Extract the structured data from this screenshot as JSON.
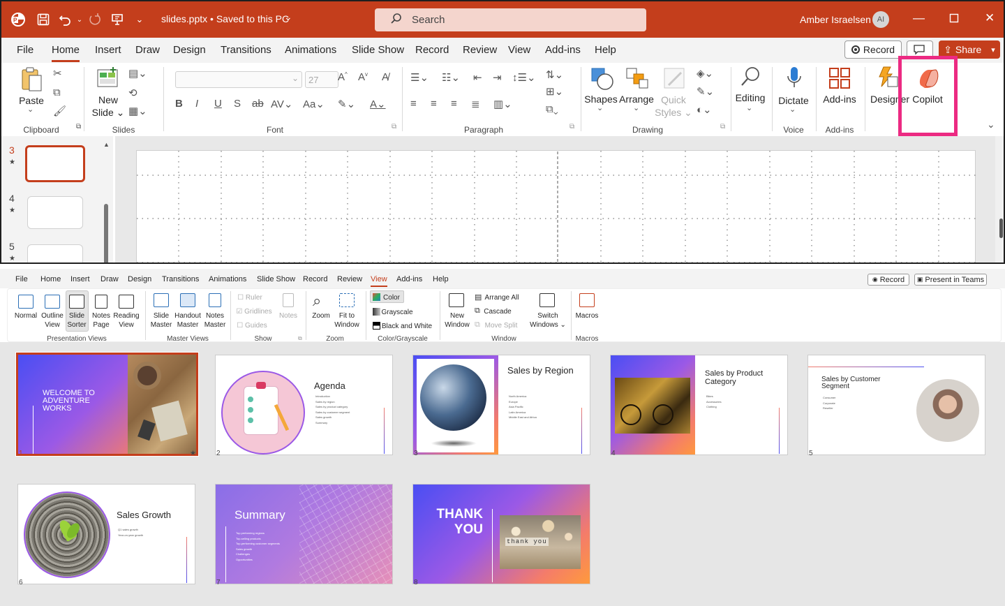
{
  "top": {
    "file_name": "slides.pptx  •  Saved to this PC",
    "search_placeholder": "Search",
    "user_name": "Amber Israelsen",
    "user_initials": "AI",
    "menu_tabs": [
      "File",
      "Home",
      "Insert",
      "Draw",
      "Design",
      "Transitions",
      "Animations",
      "Slide Show",
      "Record",
      "Review",
      "View",
      "Add-ins",
      "Help"
    ],
    "active_tab": "Home",
    "record_label": "Record",
    "share_label": "Share",
    "ribbon": {
      "paste": "Paste",
      "new_slide_1": "New",
      "new_slide_2": "Slide",
      "font_size": "27",
      "shapes": "Shapes",
      "arrange": "Arrange",
      "quick_styles_1": "Quick",
      "quick_styles_2": "Styles",
      "editing": "Editing",
      "dictate": "Dictate",
      "add_ins": "Add-ins",
      "designer": "Designer",
      "copilot": "Copilot"
    },
    "groups": {
      "clipboard": "Clipboard",
      "slides": "Slides",
      "font": "Font",
      "paragraph": "Paragraph",
      "drawing": "Drawing",
      "voice": "Voice",
      "add_ins": "Add-ins"
    },
    "thumb_numbers": [
      "3",
      "4",
      "5"
    ]
  },
  "bottom": {
    "menu_tabs": [
      "File",
      "Home",
      "Insert",
      "Draw",
      "Design",
      "Transitions",
      "Animations",
      "Slide Show",
      "Record",
      "Review",
      "View",
      "Add-ins",
      "Help"
    ],
    "active_tab": "View",
    "record_label": "Record",
    "present_label": "Present in Teams",
    "ribbon": {
      "normal": "Normal",
      "outline_1": "Outline",
      "outline_2": "View",
      "slide_sorter_1": "Slide",
      "slide_sorter_2": "Sorter",
      "notes_page_1": "Notes",
      "notes_page_2": "Page",
      "reading_1": "Reading",
      "reading_2": "View",
      "slide_master_1": "Slide",
      "slide_master_2": "Master",
      "handout_1": "Handout",
      "handout_2": "Master",
      "notes_master_1": "Notes",
      "notes_master_2": "Master",
      "ruler": "Ruler",
      "gridlines": "Gridlines",
      "guides": "Guides",
      "notes": "Notes",
      "zoom": "Zoom",
      "fit_1": "Fit to",
      "fit_2": "Window",
      "color": "Color",
      "grayscale": "Grayscale",
      "bw": "Black and White",
      "new_window_1": "New",
      "new_window_2": "Window",
      "arrange_all": "Arrange All",
      "cascade": "Cascade",
      "move_split": "Move Split",
      "switch_1": "Switch",
      "switch_2": "Windows",
      "macros": "Macros"
    },
    "groups": {
      "presentation_views": "Presentation Views",
      "master_views": "Master Views",
      "show": "Show",
      "zoom": "Zoom",
      "color_grayscale": "Color/Grayscale",
      "window": "Window",
      "macros": "Macros"
    },
    "slides": [
      {
        "num": "1",
        "title": "WELCOME TO ADVENTURE WORKS"
      },
      {
        "num": "2",
        "title": "Agenda",
        "bullets": [
          "Introduction",
          "Sales by region",
          "Sales by product category",
          "Sales by customer segment",
          "Sales growth",
          "Summary"
        ]
      },
      {
        "num": "3",
        "title": "Sales by Region",
        "bullets": [
          "North America",
          "Europe",
          "Asia Pacific",
          "Latin America",
          "Middle East and Africa"
        ]
      },
      {
        "num": "4",
        "title": "Sales by Product Category",
        "bullets": [
          "Bikes",
          "Accessories",
          "Clothing"
        ]
      },
      {
        "num": "5",
        "title": "Sales by Customer Segment",
        "bullets": [
          "Consumer",
          "Corporate",
          "Reseller"
        ]
      },
      {
        "num": "6",
        "title": "Sales Growth",
        "bullets": [
          "Q1 sales growth",
          "Year-on-year growth"
        ]
      },
      {
        "num": "7",
        "title": "Summary",
        "bullets": [
          "Top performing regions",
          "Top-selling products",
          "Top-performing customer segments",
          "Sales growth",
          "Challenges",
          "Opportunities"
        ]
      },
      {
        "num": "8",
        "title": "THANK YOU",
        "image_text": "thank you"
      }
    ]
  }
}
